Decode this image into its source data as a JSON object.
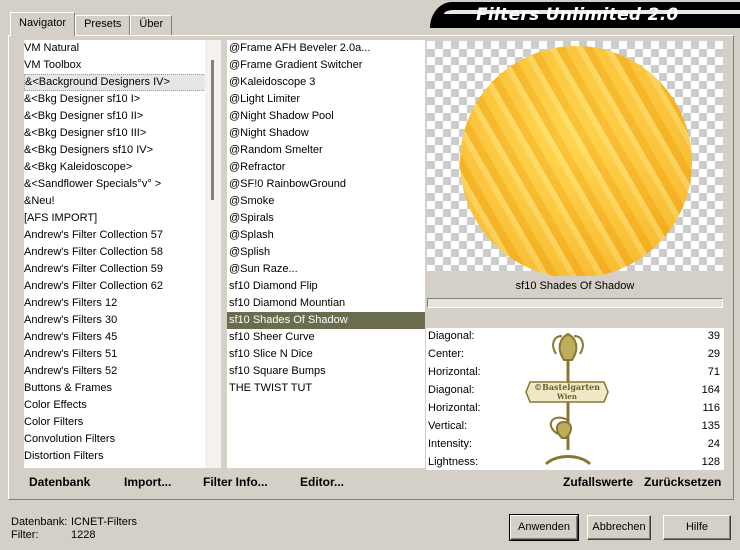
{
  "tabs": [
    "Navigator",
    "Presets",
    "Über"
  ],
  "app_title": "Filters Unlimited 2.0",
  "categories": [
    "VM Natural",
    "VM Toolbox",
    "&<Background Designers IV>",
    "&<Bkg Designer sf10 I>",
    "&<Bkg Designer sf10 II>",
    "&<Bkg Designer sf10 III>",
    "&<Bkg Designers sf10 IV>",
    "&<Bkg Kaleidoscope>",
    "&<Sandflower Specials°v° >",
    "&Neu!",
    "[AFS IMPORT]",
    "Andrew's Filter Collection 57",
    "Andrew's Filter Collection 58",
    "Andrew's Filter Collection 59",
    "Andrew's Filter Collection 62",
    "Andrew's Filters 12",
    "Andrew's Filters 30",
    "Andrew's Filters 45",
    "Andrew's Filters 51",
    "Andrew's Filters 52",
    "Buttons & Frames",
    "Color Effects",
    "Color Filters",
    "Convolution Filters",
    "Distortion Filters"
  ],
  "selected_category_index": 2,
  "filters": [
    "@Frame AFH Beveler 2.0a...",
    "@Frame Gradient Switcher",
    "@Kaleidoscope 3",
    "@Light Limiter",
    "@Night Shadow Pool",
    "@Night Shadow",
    "@Random Smelter",
    "@Refractor",
    "@SF!0 RainbowGround",
    "@Smoke",
    "@Spirals",
    "@Splash",
    "@Splish",
    "@Sun Raze...",
    "sf10 Diamond Flip",
    "sf10 Diamond Mountian",
    "sf10 Shades Of Shadow",
    "sf10 Sheer Curve",
    "sf10 Slice N Dice",
    "sf10 Square Bumps",
    "THE TWIST TUT"
  ],
  "selected_filter_index": 16,
  "current_filter": "sf10 Shades Of Shadow",
  "params": [
    {
      "label": "Diagonal:",
      "value": "39"
    },
    {
      "label": "Center:",
      "value": "29"
    },
    {
      "label": "Horizontal:",
      "value": "71"
    },
    {
      "label": "Diagonal:",
      "value": "164"
    },
    {
      "label": "Horizontal:",
      "value": "116"
    },
    {
      "label": "Vertical:",
      "value": "135"
    },
    {
      "label": "Intensity:",
      "value": "24"
    },
    {
      "label": "Lightness:",
      "value": "128"
    }
  ],
  "watermark_text": [
    "©Bastelgarten",
    "Wien"
  ],
  "bottom_buttons": {
    "datenbank": "Datenbank",
    "import": "Import...",
    "filter_info": "Filter Info...",
    "editor": "Editor...",
    "zufallswerte": "Zufallswerte",
    "zuruecksetzen": "Zurücksetzen"
  },
  "footer": {
    "db_label": "Datenbank:",
    "db_value": "ICNET-Filters",
    "filter_label": "Filter:",
    "filter_value": "1228"
  },
  "dialog_buttons": {
    "apply": "Anwenden",
    "cancel": "Abbrechen",
    "help": "Hilfe"
  },
  "colors": {
    "selection_bg": "#6b6b4e",
    "window_bg": "#d4d0c8",
    "orb": "#f6b326",
    "watermark": "#7a6a1e"
  }
}
